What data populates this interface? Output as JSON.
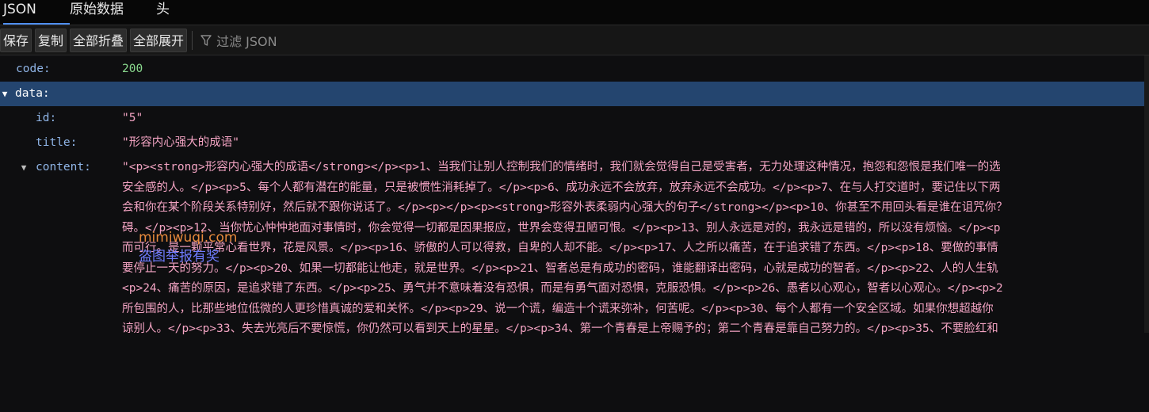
{
  "tabs": [
    {
      "label": "JSON",
      "active": true
    },
    {
      "label": "原始数据",
      "active": false
    },
    {
      "label": "头",
      "active": false
    }
  ],
  "toolbar": {
    "save_label": "保存",
    "copy_label": "复制",
    "collapse_all_label": "全部折叠",
    "expand_all_label": "全部展开",
    "filter_placeholder": "过滤 JSON"
  },
  "tree": {
    "code": {
      "key": "code:",
      "value": "200"
    },
    "data": {
      "key": "data:"
    },
    "id": {
      "key": "id:",
      "value": "\"5\""
    },
    "title": {
      "key": "title:",
      "value": "\"形容内心强大的成语\""
    },
    "content": {
      "key": "content:",
      "lines": [
        "\"<p><strong>形容内心强大的成语</strong></p><p>1、当我们让别人控制我们的情绪时，我们就会觉得自己是受害者，无力处理这种情况，抱怨和怨恨是我们唯一的选",
        "安全感的人。</p><p>5、每个人都有潜在的能量，只是被惯性消耗掉了。</p><p>6、成功永远不会放弃，放弃永远不会成功。</p><p>7、在与人打交道时，要记住以下两",
        "会和你在某个阶段关系特别好，然后就不跟你说话了。</p><p></p><p><strong>形容外表柔弱内心强大的句子</strong></p><p>10、你甚至不用回头看是谁在诅咒你？",
        "碍。</p><p>12、当你忧心忡忡地面对事情时，你会觉得一切都是因果报应，世界会变得丑陋可恨。</p><p>13、别人永远是对的，我永远是错的，所以没有烦恼。</p><p",
        "而可行。是一颗平常心看世界，花是风景。</p><p>16、骄傲的人可以得救，自卑的人却不能。</p><p>17、人之所以痛苦，在于追求错了东西。</p><p>18、要做的事情",
        "要停止一天的努力。</p><p>20、如果一切都能让他走，就是世界。</p><p>21、智者总是有成功的密码，谁能翻译出密码，心就是成功的智者。</p><p>22、人的人生轨",
        "<p>24、痛苦的原因，是追求错了东西。</p><p>25、勇气并不意味着没有恐惧，而是有勇气面对恐惧，克服恐惧。</p><p>26、愚者以心观心，智者以心观心。</p><p>2",
        "所包围的人，比那些地位低微的人更珍惜真诚的爱和关怀。</p><p>29、说一个谎，编造十个谎来弥补，何苦呢。</p><p>30、每个人都有一个安全区域。如果你想超越你",
        "谅别人。</p><p>33、失去光亮后不要惊慌，你仍然可以看到天上的星星。</p><p>34、第一个青春是上帝赐予的；第二个青春是靠自己努力的。</p><p>35、不要脸红和"
      ]
    }
  },
  "watermark": {
    "line1": "mimiwuqi.com",
    "line2": "盗图举报有奖"
  }
}
